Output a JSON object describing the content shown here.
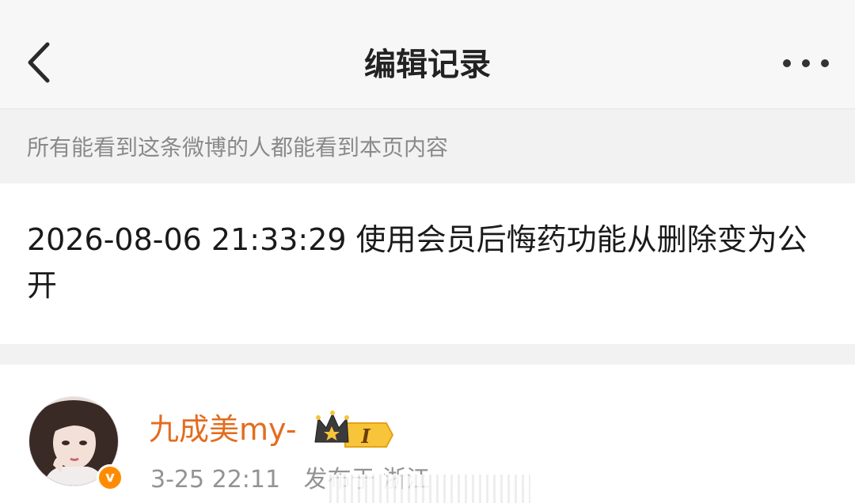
{
  "header": {
    "title": "编辑记录",
    "back_icon": "chevron-left-icon",
    "more_icon": "ellipsis-icon"
  },
  "notice": {
    "text": "所有能看到这条微博的人都能看到本页内容"
  },
  "edit_record": {
    "text": "2026-08-06 21:33:29 使用会员后悔药功能从删除变为公开"
  },
  "post": {
    "username": "九成美my-",
    "vip_badge_level": "I",
    "verified_icon": "verified-v-icon",
    "verified_mark": "v",
    "time": "3-25 22:11",
    "location": "发布于 浙江"
  },
  "colors": {
    "username": "#e46c1e",
    "verified_badge": "#ff8c00",
    "vip_badge": "#f2a31c",
    "notice_bg": "#f2f2f2",
    "muted_text": "#8a8a8a"
  }
}
